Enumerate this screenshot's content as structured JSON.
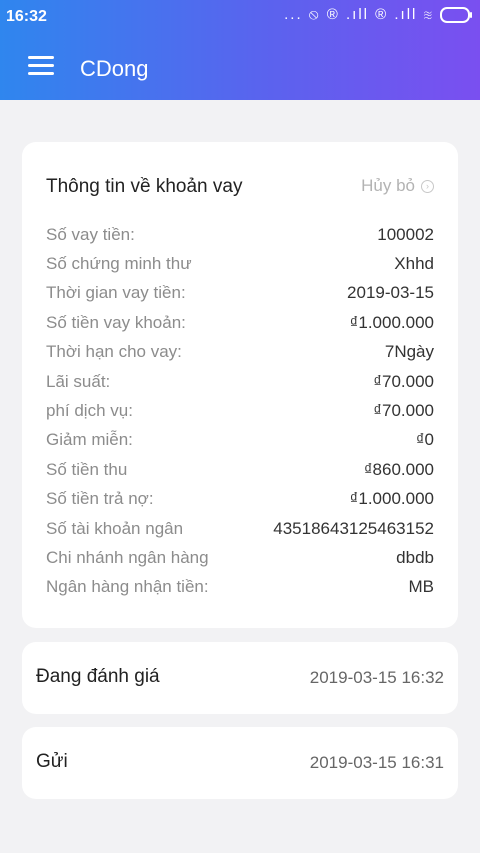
{
  "status_bar": {
    "time": "16:32",
    "icons": "... ⦸ ® .ıll ® .ıll ≋"
  },
  "header": {
    "title": "CDong"
  },
  "loan_card": {
    "title": "Thông tin về khoản vay",
    "cancel_label": "Hủy bỏ",
    "rows": [
      {
        "label": "Số vay tiền:",
        "value": "100002"
      },
      {
        "label": "Số chứng minh thư",
        "value": "Xhhd"
      },
      {
        "label": "Thời gian vay tiền:",
        "value": "2019-03-15"
      },
      {
        "label": "Số tiền vay khoản:",
        "value": "₫1.000.000"
      },
      {
        "label": "Thời hạn cho vay:",
        "value": "7Ngày"
      },
      {
        "label": "Lãi suất:",
        "value": "₫70.000"
      },
      {
        "label": "phí dịch vụ:",
        "value": "₫70.000"
      },
      {
        "label": "Giảm miễn:",
        "value": "₫0"
      },
      {
        "label": "Số tiền thu",
        "value": "₫860.000"
      },
      {
        "label": "Số tiền trả nợ:",
        "value": "₫1.000.000"
      },
      {
        "label": "Số tài khoản ngân",
        "value": "43518643125463152"
      },
      {
        "label": "Chi nhánh ngân hàng",
        "value": "dbdb"
      },
      {
        "label": "Ngân hàng nhận tiền:",
        "value": "MB"
      }
    ]
  },
  "status_items": [
    {
      "label": "Đang đánh giá",
      "time": "2019-03-15 16:32"
    },
    {
      "label": "Gửi",
      "time": "2019-03-15 16:31"
    }
  ]
}
